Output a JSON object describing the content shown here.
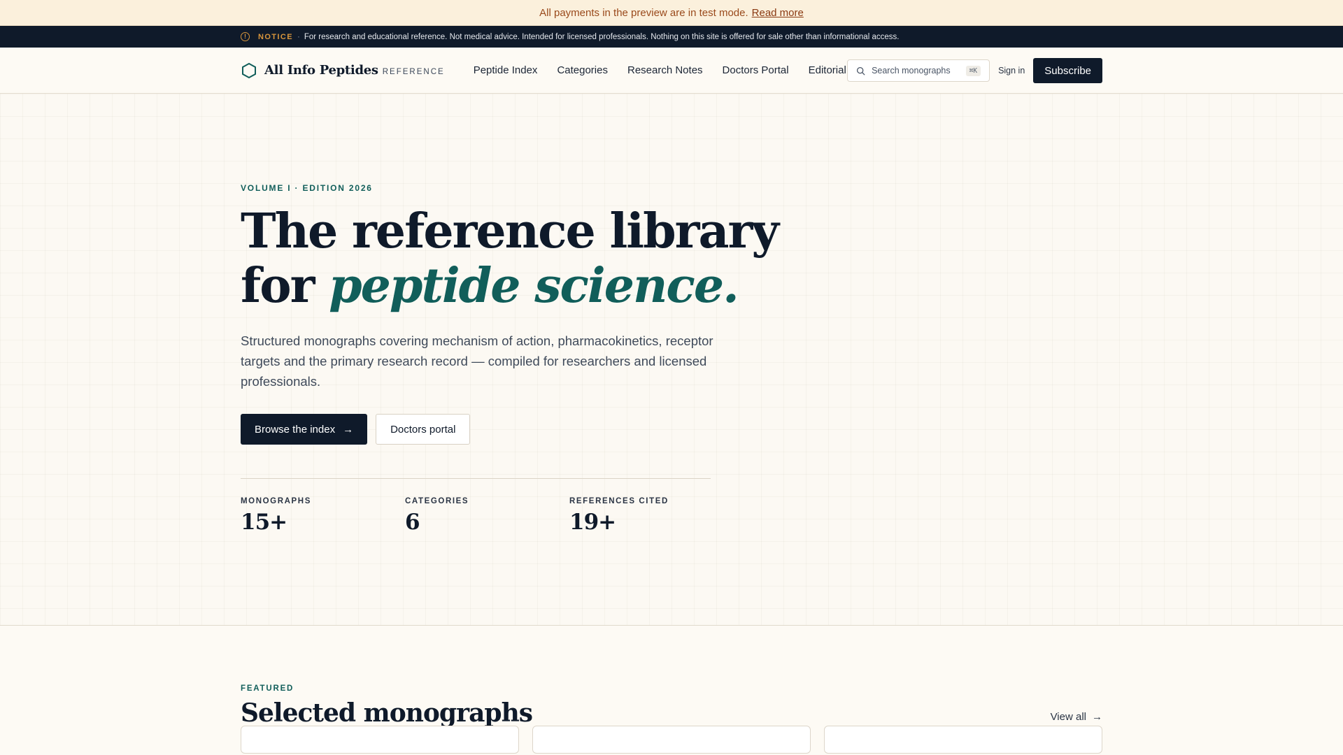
{
  "banner": {
    "text": "All payments in the preview are in test mode.",
    "link": "Read more"
  },
  "notice": {
    "icon": "info-icon",
    "label": "NOTICE",
    "separator": "·",
    "text": "For research and educational reference. Not medical advice. Intended for licensed professionals. Nothing on this site is offered for sale other than informational access."
  },
  "header": {
    "brand_name": "All Info Peptides",
    "brand_tag": "REFERENCE",
    "nav": [
      "Peptide Index",
      "Categories",
      "Research Notes",
      "Doctors Portal",
      "Editorial"
    ],
    "search_placeholder": "Search monographs",
    "search_shortcut": "⌘K",
    "signin": "Sign in",
    "subscribe": "Subscribe"
  },
  "hero": {
    "eyebrow": "VOLUME I · EDITION 2026",
    "title_line1": "The reference library",
    "title_line2_prefix": "for ",
    "title_line2_accent": "peptide science.",
    "description": "Structured monographs covering mechanism of action, pharmacokinetics, receptor targets and the primary research record — compiled for researchers and licensed professionals.",
    "primary_cta": "Browse the index",
    "secondary_cta": "Doctors portal",
    "stats": [
      {
        "label": "MONOGRAPHS",
        "value": "15+"
      },
      {
        "label": "CATEGORIES",
        "value": "6"
      },
      {
        "label": "REFERENCES CITED",
        "value": "19+"
      }
    ]
  },
  "featured": {
    "eyebrow": "FEATURED",
    "title": "Selected monographs",
    "view_all": "View all"
  },
  "colors": {
    "accent": "#115e5a",
    "ink": "#0f1a2a",
    "notice": "#d9963c",
    "background": "#fcf9f3"
  }
}
